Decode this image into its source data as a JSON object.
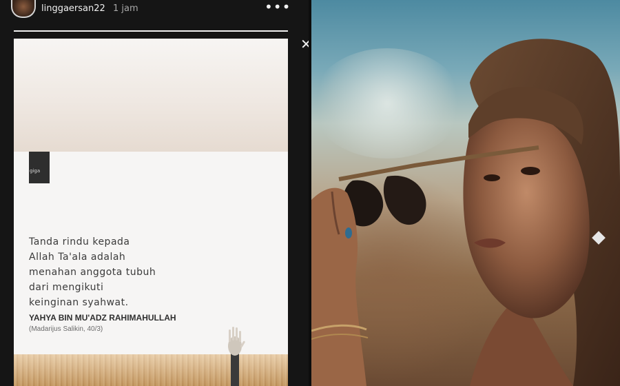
{
  "story": {
    "username": "linggaersan22",
    "time": "1 jam",
    "more_icon": "more-horizontal-icon",
    "close_icon": "close-icon",
    "progress": 1.0
  },
  "card": {
    "quote": "Tanda rindu kepada Allah Ta'ala adalah menahan anggota tubuh dari mengikuti keinginan syahwat.",
    "quote_lines": [
      "Tanda rindu kepada",
      "Allah Ta'ala adalah",
      "menahan anggota tubuh",
      "dari mengikuti",
      "keinginan syahwat."
    ],
    "author": "YAHYA BIN MU'ADZ RAHIMAHULLAH",
    "source": "(Madarijus Salikin, 40/3)",
    "logo_text": "giga"
  },
  "colors": {
    "card_bg": "#f6f5f4",
    "field": "#c79c63",
    "sky": "#4d8aa1"
  }
}
